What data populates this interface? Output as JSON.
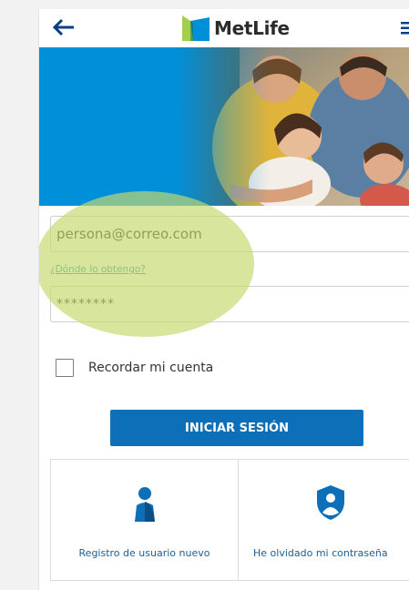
{
  "header": {
    "brand": "MetLife",
    "back_icon": "arrow-left-icon",
    "menu_icon": "hamburger-menu-icon"
  },
  "hero": {
    "image": "family-photo"
  },
  "login": {
    "email_value": "persona@correo.com",
    "where_link": "¿Dónde lo obtengo?",
    "password_value": "********",
    "remember_label": "Recordar mi cuenta",
    "submit_label": "INICIAR SESIÓN"
  },
  "cards": {
    "register_label": "Registro de usuario nuevo",
    "register_icon": "user-icon",
    "forgot_label": "He olvidado mi contraseña",
    "forgot_icon": "shield-user-icon"
  },
  "colors": {
    "brand_blue": "#0090da",
    "button_blue": "#0d6fb8",
    "brand_green": "#a4ce4e",
    "link_teal": "#1f8ea0",
    "highlight_green": "#c4d96e"
  }
}
